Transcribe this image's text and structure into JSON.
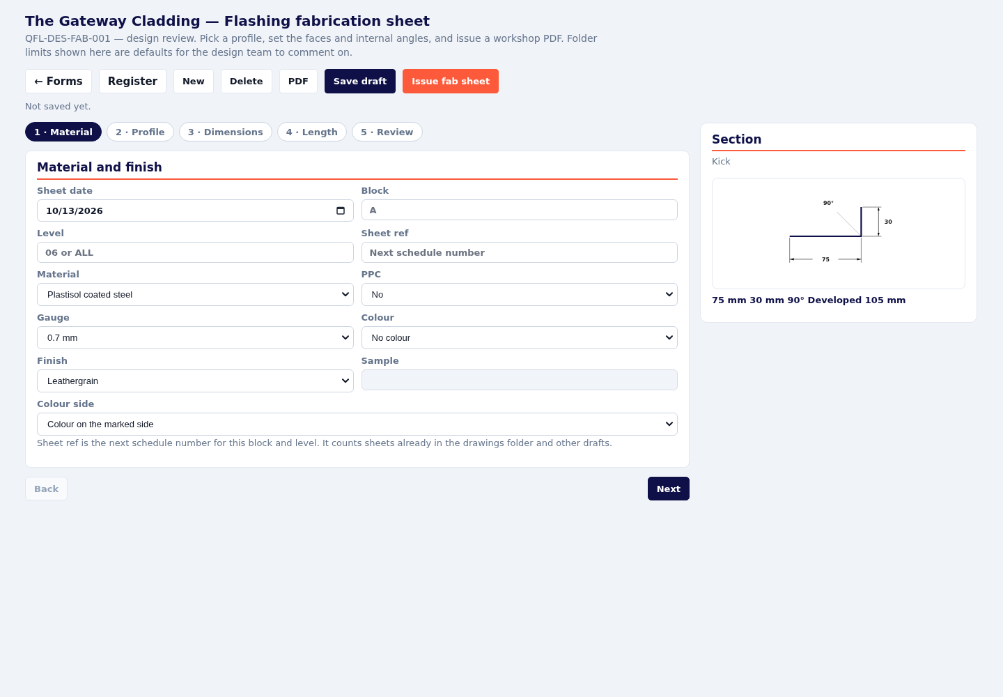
{
  "header": {
    "title": "The Gateway Cladding — Flashing fabrication sheet",
    "description": "QFL-DES-FAB-001 — design review. Pick a profile, set the faces and internal angles, and issue a workshop PDF. Folder limits shown here are defaults for the design team to comment on."
  },
  "toolbar": [
    {
      "label": "← Forms",
      "kind": "nav"
    },
    {
      "label": "Register",
      "kind": "nav"
    },
    {
      "label": "New",
      "kind": "plain"
    },
    {
      "label": "Delete",
      "kind": "plain"
    },
    {
      "label": "PDF",
      "kind": "plain"
    },
    {
      "label": "Save draft",
      "kind": "primary"
    },
    {
      "label": "Issue fab sheet",
      "kind": "accent"
    }
  ],
  "save_status": "Not saved yet.",
  "steps": [
    {
      "label": "1 · Material",
      "selected": true
    },
    {
      "label": "2 · Profile",
      "selected": false
    },
    {
      "label": "3 · Dimensions",
      "selected": false
    },
    {
      "label": "4 · Length",
      "selected": false
    },
    {
      "label": "5 · Review",
      "selected": false
    }
  ],
  "form": {
    "title": "Material and finish",
    "fields": [
      {
        "label": "Sheet date",
        "kind": "date",
        "value": "10/13/2026",
        "disabled": false
      },
      {
        "label": "Block",
        "kind": "text",
        "placeholder": "A",
        "disabled": false
      },
      {
        "label": "Level",
        "kind": "text",
        "placeholder": "06 or ALL",
        "disabled": false
      },
      {
        "label": "Sheet ref",
        "kind": "text",
        "placeholder": "Next schedule number",
        "disabled": false
      },
      {
        "label": "Material",
        "kind": "select",
        "value": "Plastisol coated steel",
        "disabled": false
      },
      {
        "label": "PPC",
        "kind": "select",
        "value": "No",
        "disabled": false
      },
      {
        "label": "Gauge",
        "kind": "select",
        "value": "0.7 mm",
        "disabled": false
      },
      {
        "label": "Colour",
        "kind": "select",
        "value": "No colour",
        "disabled": false
      },
      {
        "label": "Finish",
        "kind": "select",
        "value": "Leathergrain",
        "disabled": false
      },
      {
        "label": "Sample",
        "kind": "text",
        "disabled": true
      }
    ],
    "wide_field": {
      "label": "Colour side",
      "kind": "select",
      "value": "Colour on the marked side",
      "disabled": false
    },
    "note": "Sheet ref is the next schedule number for this block and level. It counts sheets already in the drawings folder and other drafts."
  },
  "navigation": {
    "back": {
      "label": "Back",
      "disabled": true
    },
    "next": {
      "label": "Next",
      "disabled": false
    }
  },
  "section": {
    "title": "Section",
    "profile": "Kick",
    "drawing": {
      "angle_label": "90°",
      "height_label": "30",
      "width_label": "75"
    },
    "summary": "75 mm 30 mm 90° Developed 105 mm"
  }
}
